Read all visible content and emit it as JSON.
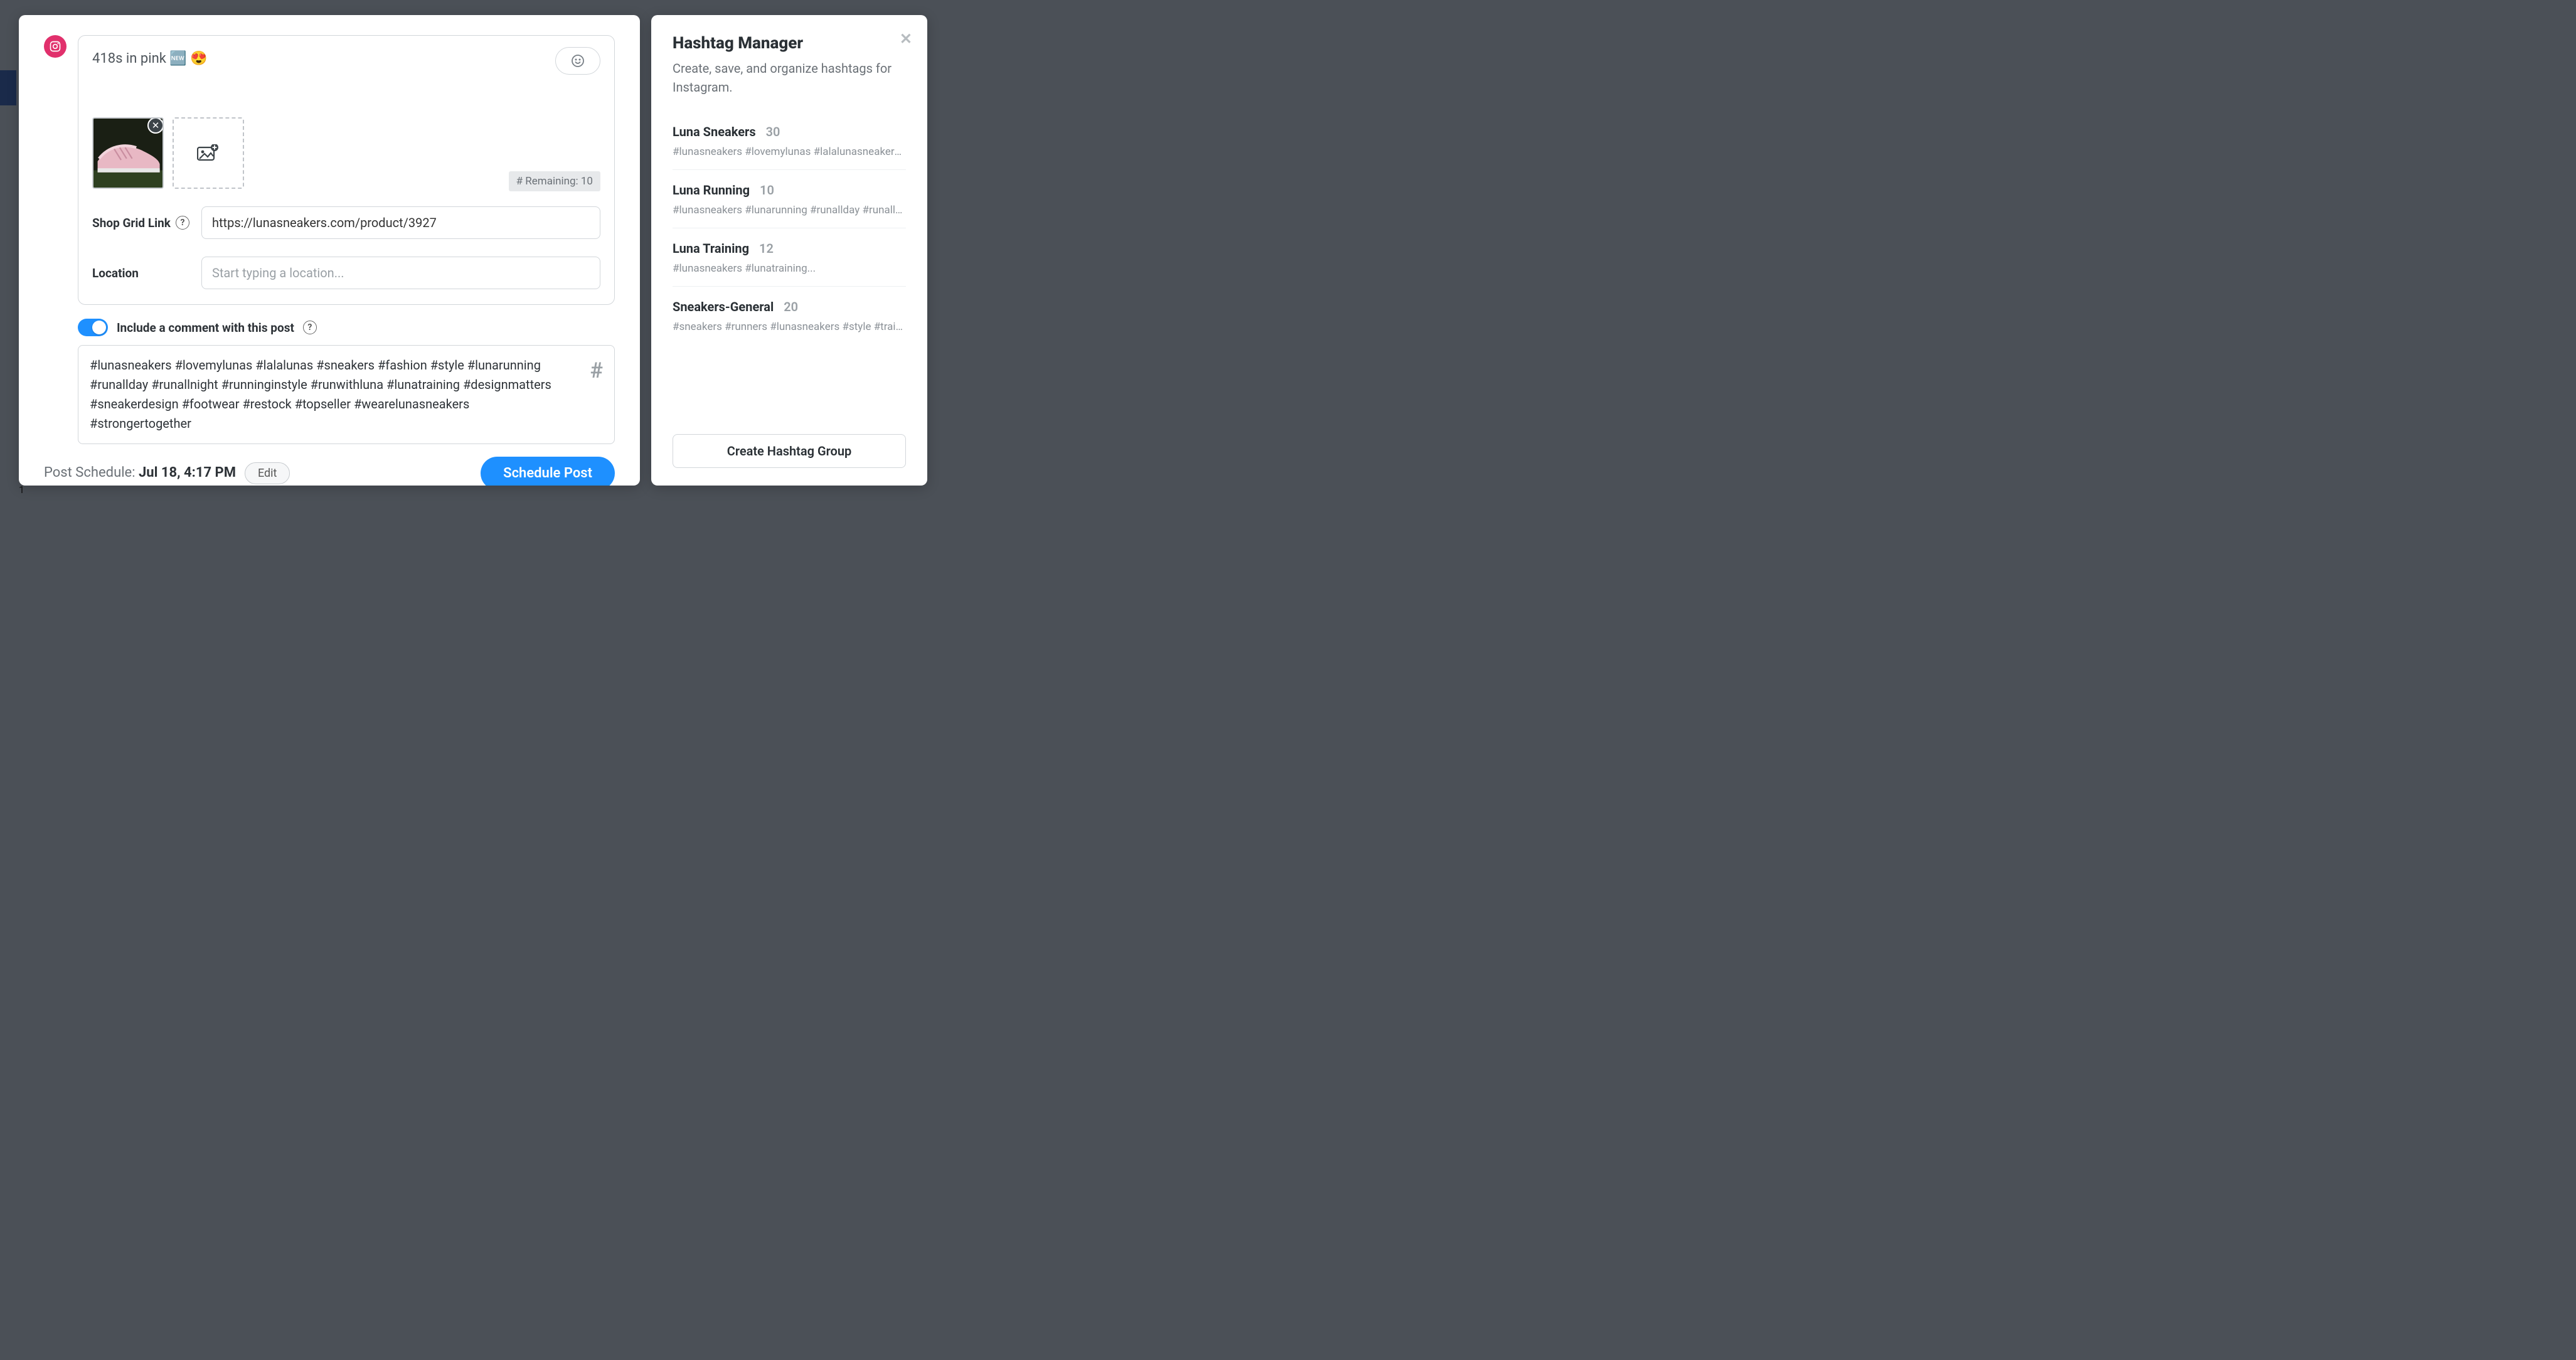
{
  "composer": {
    "caption": "418s in pink 🆕  😍",
    "remaining_label": "# Remaining: 10",
    "shop_grid": {
      "label": "Shop Grid Link",
      "value": "https://lunasneakers.com/product/3927"
    },
    "location": {
      "label": "Location",
      "placeholder": "Start typing a location..."
    },
    "toggle_label": "Include a comment with this post",
    "comment_text": "#lunasneakers #lovemylunas #lalalunas #sneakers #fashion #style #lunarunning #runallday #runallnight #runninginstyle #runwithluna #lunatraining #designmatters #sneakerdesign #footwear #restock #topseller #wearelunasneakers #strongertogether"
  },
  "footer": {
    "schedule_prefix": "Post Schedule: ",
    "schedule_time": "Jul 18, 4:17 PM",
    "edit_label": "Edit",
    "schedule_btn": "Schedule Post"
  },
  "hashtag_manager": {
    "title": "Hashtag Manager",
    "subtitle": "Create, save, and organize hashtags for Instagram.",
    "create_btn": "Create Hashtag Group",
    "groups": [
      {
        "name": "Luna Sneakers",
        "count": "30",
        "tags": "#lunasneakers #lovemylunas #lalalunasneakers..."
      },
      {
        "name": "Luna Running",
        "count": "10",
        "tags": "#lunasneakers #lunarunning #runallday #runalln..."
      },
      {
        "name": "Luna Training",
        "count": "12",
        "tags": "#lunasneakers #lunatraining..."
      },
      {
        "name": "Sneakers-General",
        "count": "20",
        "tags": "#sneakers #runners #lunasneakers #style #train..."
      }
    ]
  },
  "bg_number": "1"
}
